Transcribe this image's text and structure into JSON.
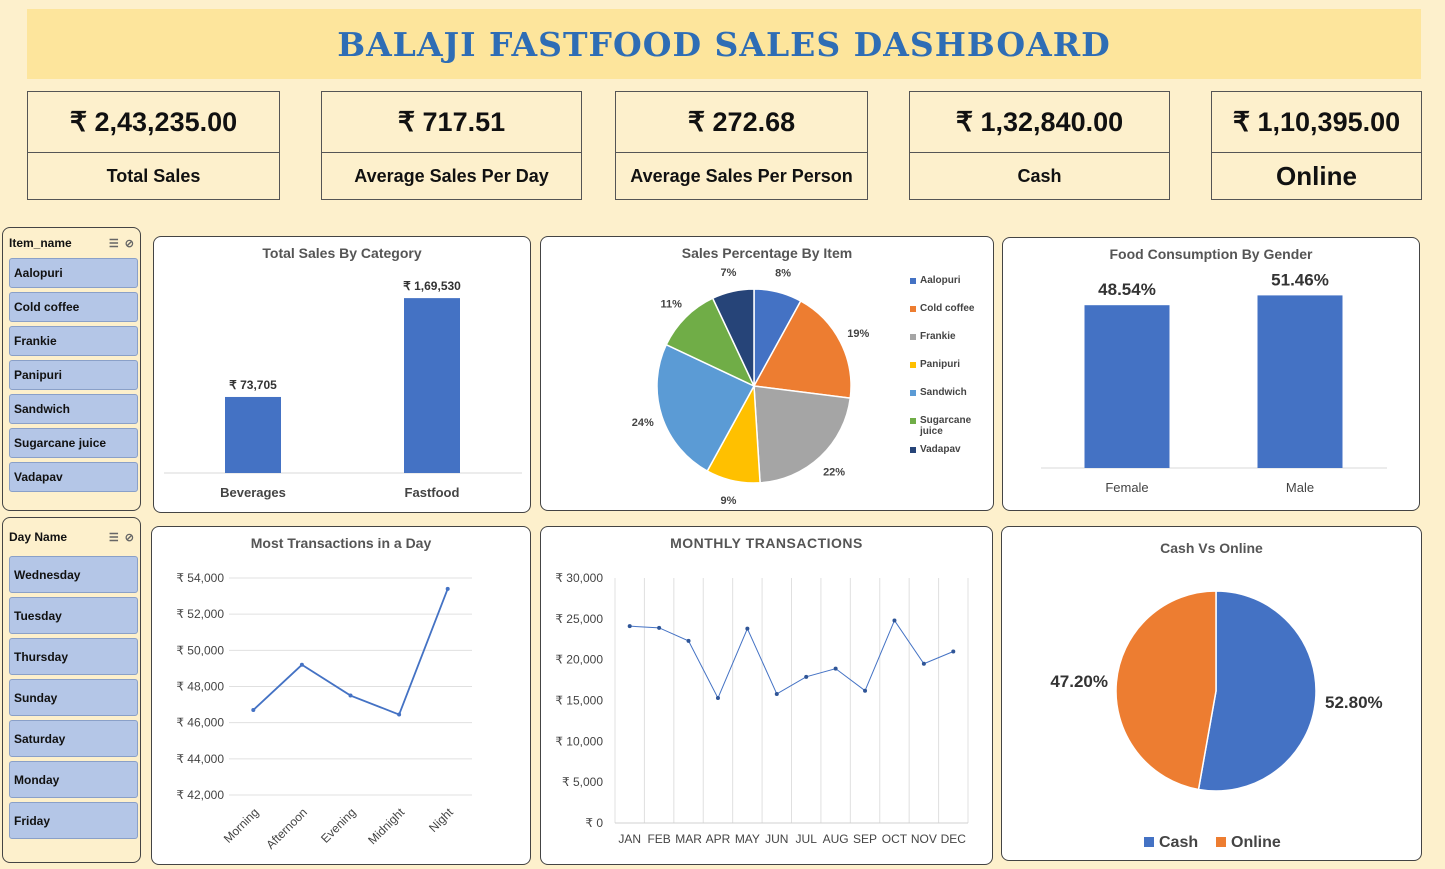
{
  "title": "BALAJI FASTFOOD SALES DASHBOARD",
  "kpis": [
    {
      "value": "₹ 2,43,235.00",
      "label": "Total Sales"
    },
    {
      "value": "₹ 717.51",
      "label": "Average Sales Per Day"
    },
    {
      "value": "₹ 272.68",
      "label": "Average Sales Per Person"
    },
    {
      "value": "₹ 1,32,840.00",
      "label": "Cash"
    },
    {
      "value": "₹ 1,10,395.00",
      "label": "Online"
    }
  ],
  "slicers": {
    "item": {
      "header": "Item_name",
      "items": [
        "Aalopuri",
        "Cold coffee",
        "Frankie",
        "Panipuri",
        "Sandwich",
        "Sugarcane juice",
        "Vadapav"
      ]
    },
    "day": {
      "header": "Day Name",
      "items": [
        "Wednesday",
        "Tuesday",
        "Thursday",
        "Sunday",
        "Saturday",
        "Monday",
        "Friday"
      ]
    }
  },
  "colors": {
    "blue": "#4472c4",
    "orange": "#ed7d31",
    "grey": "#a5a5a5",
    "gold": "#ffc000",
    "lightblue": "#5b9bd5",
    "green": "#70ad47",
    "navy": "#264478"
  },
  "chart_data": [
    {
      "id": "category",
      "type": "bar",
      "title": "Total Sales By Category",
      "categories": [
        "Beverages",
        "Fastfood"
      ],
      "values": [
        73705,
        169530
      ],
      "data_labels": [
        "₹ 73,705",
        "₹ 1,69,530"
      ],
      "ylim": [
        0,
        190000
      ]
    },
    {
      "id": "item-pie",
      "type": "pie",
      "title": "Sales Percentage By Item",
      "labels": [
        "Aalopuri",
        "Cold coffee",
        "Frankie",
        "Panipuri",
        "Sandwich",
        "Sugarcane juice",
        "Vadapav"
      ],
      "values": [
        8,
        19,
        22,
        9,
        24,
        11,
        7
      ],
      "data_labels": [
        "8%",
        "19%",
        "22%",
        "9%",
        "24%",
        "11%",
        "7%"
      ],
      "colors": [
        "#4472c4",
        "#ed7d31",
        "#a5a5a5",
        "#ffc000",
        "#5b9bd5",
        "#70ad47",
        "#264478"
      ],
      "legend": "right"
    },
    {
      "id": "gender",
      "type": "bar",
      "title": "Food Consumption By Gender",
      "categories": [
        "Female",
        "Male"
      ],
      "values": [
        48.54,
        51.46
      ],
      "data_labels": [
        "48.54%",
        "51.46%"
      ],
      "ylim": [
        0,
        58
      ]
    },
    {
      "id": "daytime",
      "type": "line",
      "title": "Most Transactions in a Day",
      "categories": [
        "Morning",
        "Afternoon",
        "Evening",
        "Midnight",
        "Night"
      ],
      "values": [
        46700,
        49200,
        47500,
        46450,
        53400
      ],
      "ylim": [
        42000,
        54000
      ],
      "yticks": [
        54000,
        52000,
        50000,
        48000,
        46000,
        44000,
        42000
      ],
      "ytick_labels": [
        "₹ 54,000",
        "₹ 52,000",
        "₹ 50,000",
        "₹ 48,000",
        "₹ 46,000",
        "₹ 44,000",
        "₹ 42,000"
      ],
      "grid": true
    },
    {
      "id": "monthly",
      "type": "line",
      "title": "MONTHLY TRANSACTIONS",
      "categories": [
        "JAN",
        "FEB",
        "MAR",
        "APR",
        "MAY",
        "JUN",
        "JUL",
        "AUG",
        "SEP",
        "OCT",
        "NOV",
        "DEC"
      ],
      "values": [
        24100,
        23900,
        22300,
        15300,
        23800,
        15800,
        17900,
        18900,
        16200,
        24800,
        19500,
        21000
      ],
      "ylim": [
        0,
        30000
      ],
      "yticks": [
        30000,
        25000,
        20000,
        15000,
        10000,
        5000,
        0
      ],
      "ytick_labels": [
        "₹ 30,000",
        "₹ 25,000",
        "₹ 20,000",
        "₹ 15,000",
        "₹ 10,000",
        "₹ 5,000",
        "₹ 0"
      ],
      "grid": true
    },
    {
      "id": "cash-online",
      "type": "pie",
      "title": "Cash Vs Online",
      "labels": [
        "Cash",
        "Online"
      ],
      "values": [
        52.8,
        47.2
      ],
      "data_labels": [
        "52.80%",
        "47.20%"
      ],
      "colors": [
        "#4472c4",
        "#ed7d31"
      ],
      "legend": "bottom"
    }
  ]
}
